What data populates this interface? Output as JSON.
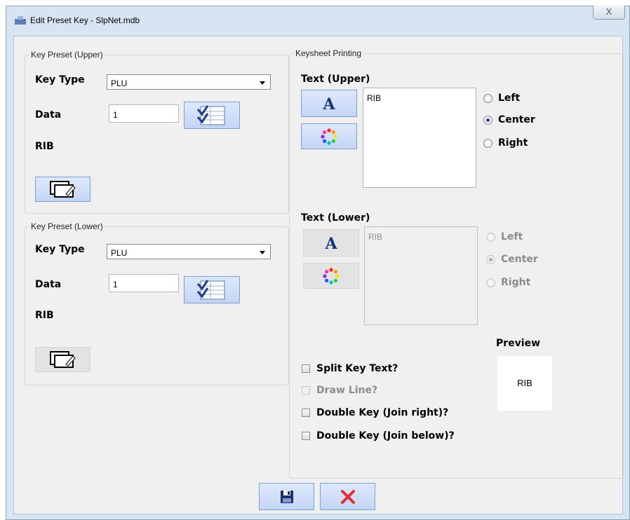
{
  "window": {
    "title": "Edit Preset Key - SlpNet.mdb",
    "close_glyph": "X"
  },
  "upper": {
    "group_title": "Key Preset (Upper)",
    "key_type_label": "Key Type",
    "key_type_value": "PLU",
    "data_label": "Data",
    "data_value": "1",
    "result_label": "RIB"
  },
  "lower": {
    "group_title": "Key Preset (Lower)",
    "key_type_label": "Key Type",
    "key_type_value": "PLU",
    "data_label": "Data",
    "data_value": "1",
    "result_label": "RIB"
  },
  "keysheet": {
    "group_title": "Keysheet Printing",
    "text_upper_label": "Text (Upper)",
    "text_upper_value": "RIB",
    "text_lower_label": "Text (Lower)",
    "text_lower_value": "RIB",
    "font_button_glyph": "A",
    "align_options": [
      "Left",
      "Center",
      "Right"
    ],
    "align_selected": "Center",
    "split_key_text": "Split Key Text?",
    "draw_line": "Draw Line?",
    "double_key_right": "Double Key (Join right)?",
    "double_key_below": "Double Key (Join below)?",
    "preview_label": "Preview",
    "preview_text": "RIB"
  },
  "icons": [
    "app-icon",
    "close-icon",
    "list-select-icon",
    "edit-window-icon",
    "font-icon",
    "color-wheel-icon",
    "save-icon",
    "cancel-icon"
  ]
}
